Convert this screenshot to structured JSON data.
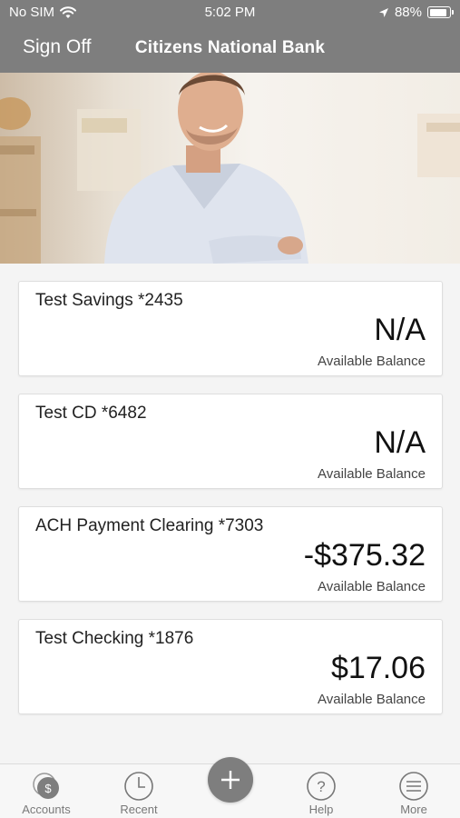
{
  "status_bar": {
    "carrier": "No SIM",
    "time": "5:02 PM",
    "battery": "88%"
  },
  "header": {
    "left_button": "Sign Off",
    "title": "Citizens National Bank"
  },
  "accounts": [
    {
      "name": "Test Savings *2435",
      "amount": "N/A",
      "label": "Available Balance"
    },
    {
      "name": "Test CD *6482",
      "amount": "N/A",
      "label": "Available Balance"
    },
    {
      "name": "ACH Payment Clearing *7303",
      "amount": "-$375.32",
      "label": "Available Balance"
    },
    {
      "name": "Test Checking *1876",
      "amount": "$17.06",
      "label": "Available Balance"
    }
  ],
  "tabs": {
    "accounts": "Accounts",
    "recent": "Recent",
    "help": "Help",
    "more": "More"
  },
  "colors": {
    "header_bg": "#7e7e7e",
    "page_bg": "#f4f4f4"
  }
}
